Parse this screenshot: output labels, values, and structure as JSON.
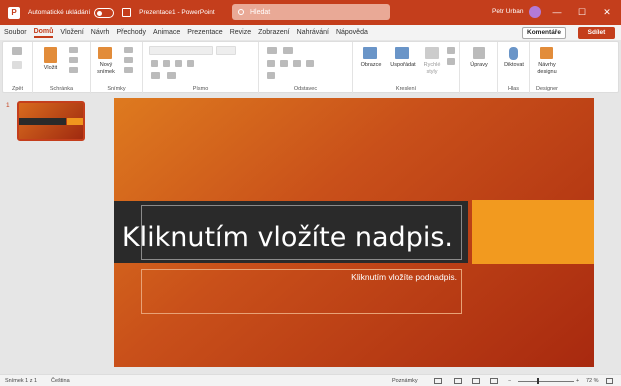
{
  "titlebar": {
    "autosave_label": "Automatické ukládání",
    "doc_title": "Prezentace1 - PowerPoint",
    "search_placeholder": "Hledat",
    "user_name": "Petr Urban",
    "minimize": "—",
    "maximize": "☐",
    "close": "✕"
  },
  "tabs": [
    "Soubor",
    "Domů",
    "Vložení",
    "Návrh",
    "Přechody",
    "Animace",
    "Prezentace",
    "Revize",
    "Zobrazení",
    "Nahrávání",
    "Nápověda"
  ],
  "actions": {
    "comments": "Komentáře",
    "share": "Sdílet"
  },
  "ribbon": {
    "groups": {
      "undo": "Zpět",
      "clipboard": "Schránka",
      "slides": "Snímky",
      "font": "Písmo",
      "paragraph": "Odstavec",
      "drawing": "Kreslení",
      "voice": "Hlas",
      "designer": "Designer"
    },
    "buttons": {
      "paste": "Vložit",
      "new_slide_1": "Nový",
      "new_slide_2": "snímek",
      "shapes": "Obrazce",
      "arrange": "Uspořádat",
      "quick_styles_1": "Rychlé",
      "quick_styles_2": "styly",
      "editing": "Úpravy",
      "dictate": "Diktovat",
      "design_ideas_1": "Návrhy",
      "design_ideas_2": "designu"
    }
  },
  "thumbnails": {
    "slide_number": "1"
  },
  "slide": {
    "title_placeholder": "Kliknutím vložíte nadpis.",
    "subtitle_placeholder": "Kliknutím vložíte podnadpis."
  },
  "statusbar": {
    "slide_info": "Snímek 1 z 1",
    "language": "Čeština",
    "notes": "Poznámky",
    "zoom": "72 %"
  },
  "colors": {
    "accent": "#c43e1c",
    "title_band": "#2a2a2a",
    "accent_block": "#f29a1f"
  }
}
